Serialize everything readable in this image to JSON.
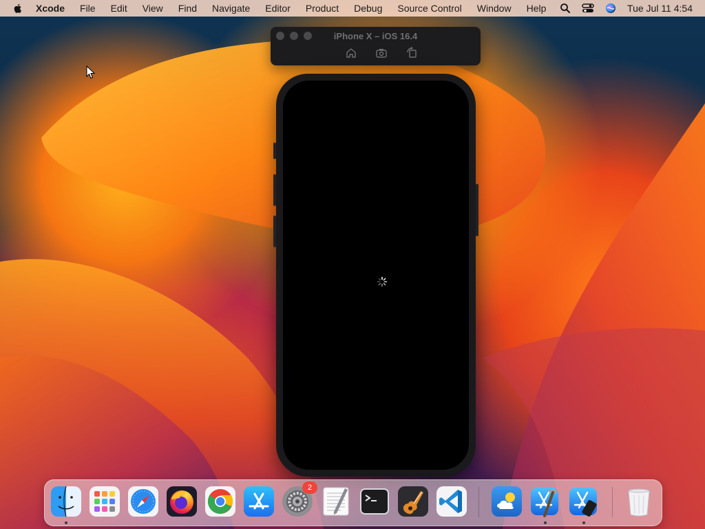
{
  "menubar": {
    "app_name": "Xcode",
    "items": [
      "File",
      "Edit",
      "View",
      "Find",
      "Navigate",
      "Editor",
      "Product",
      "Debug",
      "Source Control",
      "Window",
      "Help"
    ],
    "clock": "Tue Jul 11  4:54"
  },
  "simulator": {
    "title": "iPhone X – iOS 16.4",
    "tools": [
      "home-icon",
      "screenshot-icon",
      "rotate-icon"
    ],
    "state": "loading"
  },
  "dock": {
    "apps": [
      "Finder",
      "Launchpad",
      "Safari",
      "Firefox",
      "Google Chrome",
      "App Store",
      "System Settings",
      "TextEdit",
      "Terminal",
      "Instruments",
      "Visual Studio Code",
      "Weather",
      "Xcode",
      "Simulator",
      "Trash"
    ],
    "system_settings_badge": "2"
  },
  "colors": {
    "menubar_bg": "#ffdcc8",
    "sim_toolbar_bg": "#1c1b1d",
    "badge_red": "#f0443a"
  }
}
